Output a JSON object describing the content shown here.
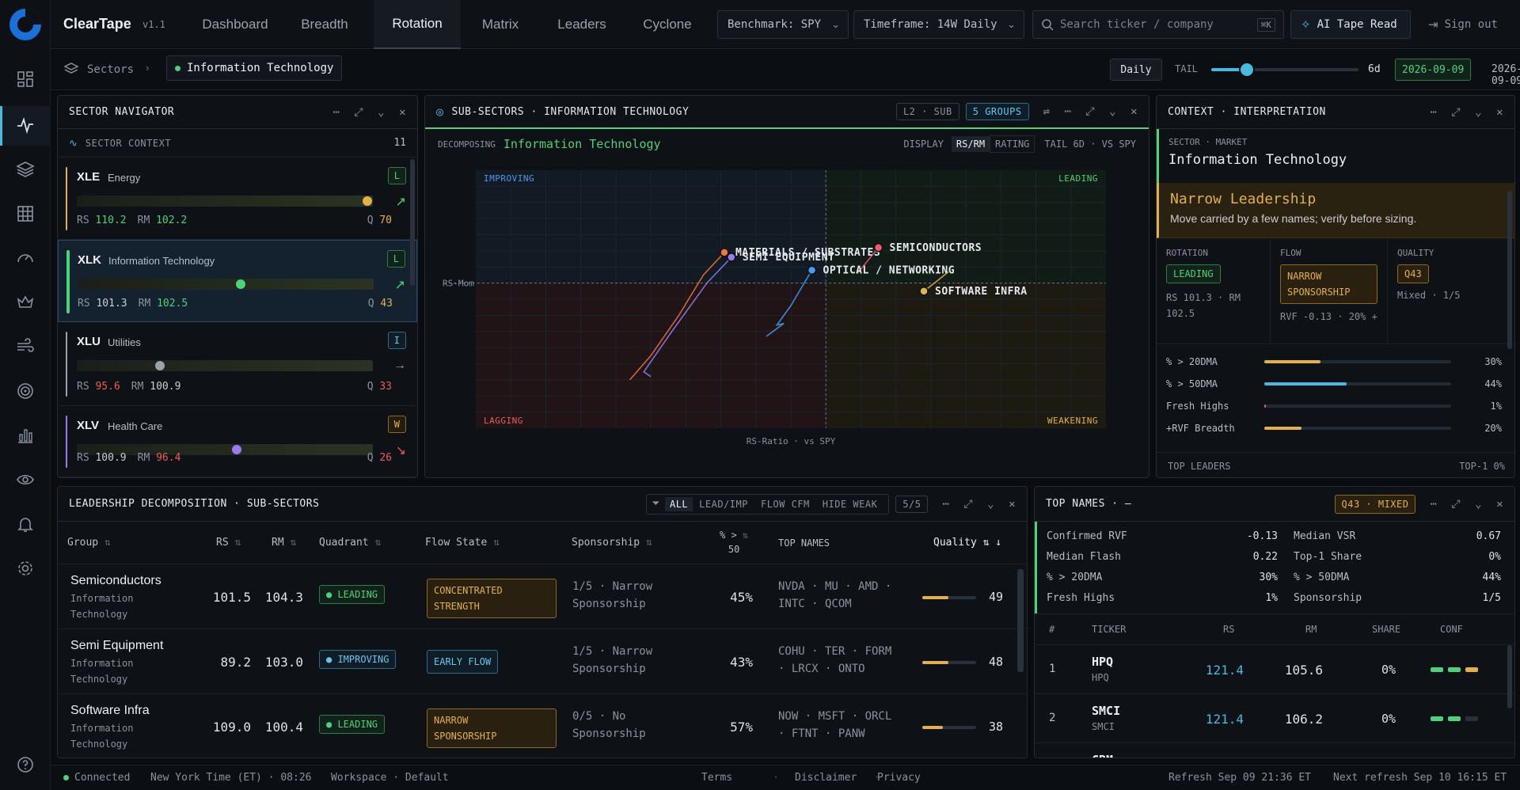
{
  "brand": {
    "name": "ClearTape",
    "version": "v1.1"
  },
  "tabs": [
    "Dashboard",
    "Breadth",
    "Rotation",
    "Matrix",
    "Leaders",
    "Cyclone"
  ],
  "active_tab": "Rotation",
  "header": {
    "benchmark": "Benchmark: SPY",
    "timeframe": "Timeframe: 14W Daily",
    "search_placeholder": "Search ticker / company",
    "search_shortcut": "⌘K",
    "ai_label": "AI Tape Read",
    "signout": "Sign out"
  },
  "crumb": {
    "root": "Sectors",
    "current": "Information Technology",
    "daily": "Daily",
    "tail_label": "TAIL",
    "tail_value": "6d",
    "date_badge": "2026-09-09",
    "date_text": "2026-09-09",
    "tail_fraction": 0.24
  },
  "navigator": {
    "title": "SECTOR NAVIGATOR",
    "context_label": "SECTOR CONTEXT",
    "count": "11",
    "sectors": [
      {
        "ticker": "XLE",
        "name": "Energy",
        "badge": "L",
        "arrow": "↗",
        "rs": "110.2",
        "rm": "102.2",
        "q": "70",
        "dot": 0.98,
        "dot_color": "#e3b04a",
        "rs_color": "#4fd07a",
        "rm_color": "#4fd07a",
        "q_color": "#e3b04a",
        "badge_color": "green"
      },
      {
        "ticker": "XLK",
        "name": "Information Technology",
        "badge": "L",
        "arrow": "↗",
        "rs": "101.3",
        "rm": "102.5",
        "q": "43",
        "dot": 0.55,
        "dot_color": "#4fd07a",
        "rs_color": "#c8cdd4",
        "rm_color": "#4fd07a",
        "q_color": "#e3b04a",
        "badge_color": "green"
      },
      {
        "ticker": "XLU",
        "name": "Utilities",
        "badge": "I",
        "arrow": "→",
        "rs": "95.6",
        "rm": "100.9",
        "q": "33",
        "dot": 0.28,
        "dot_color": "#9aa2ad",
        "rs_color": "#ef5a5a",
        "rm_color": "#c8cdd4",
        "q_color": "#ef5a5a",
        "badge_color": "blue"
      },
      {
        "ticker": "XLV",
        "name": "Health Care",
        "badge": "W",
        "arrow": "↘",
        "rs": "100.9",
        "rm": "96.4",
        "q": "26",
        "dot": 0.54,
        "dot_color": "#9b7af0",
        "rs_color": "#c8cdd4",
        "rm_color": "#ef5a5a",
        "q_color": "#ef5a5a",
        "badge_color": "amber"
      }
    ]
  },
  "subsectors": {
    "title": "SUB-SECTORS · INFORMATION TECHNOLOGY",
    "l2": "L2 · SUB",
    "groups": "5 GROUPS",
    "decomposing_label": "DECOMPOSING",
    "decomposing_value": "Information Technology",
    "display_label": "DISPLAY",
    "display_opts": [
      "RS/RM",
      "RATING"
    ],
    "tail_label": "TAIL 6D · VS SPY",
    "quadrants": {
      "improving": "IMPROVING",
      "leading": "LEADING",
      "lagging": "LAGGING",
      "weakening": "WEAKENING"
    },
    "y_axis": "RS-Mom",
    "x_axis": "RS-Ratio · vs SPY",
    "points": [
      {
        "label": "MATERIALS / SUBSTRATES",
        "x": 97.1,
        "y": 102.9,
        "color": "#f0763c",
        "tail": [
          [
            94.4,
            95.0
          ],
          [
            95.0,
            96.5
          ],
          [
            95.8,
            99.0
          ],
          [
            96.5,
            101.5
          ],
          [
            97.1,
            102.9
          ]
        ]
      },
      {
        "label": "SEMI EQUIPMENT",
        "x": 97.3,
        "y": 102.6,
        "color": "#9b7af0",
        "tail": [
          [
            95.0,
            95.2
          ],
          [
            94.8,
            95.5
          ],
          [
            95.6,
            98.0
          ],
          [
            96.6,
            101.0
          ],
          [
            97.3,
            102.6
          ]
        ]
      },
      {
        "label": "SEMICONDUCTORS",
        "x": 101.5,
        "y": 103.2,
        "color": "#f05a6a",
        "tail": [
          [
            100.9,
            101.6
          ],
          [
            101.5,
            103.2
          ]
        ]
      },
      {
        "label": "OPTICAL / NETWORKING",
        "x": 99.6,
        "y": 101.8,
        "color": "#4a9af0",
        "tail": [
          [
            98.3,
            97.7
          ],
          [
            98.8,
            98.5
          ],
          [
            98.6,
            98.4
          ],
          [
            99.0,
            99.6
          ],
          [
            99.6,
            101.8
          ]
        ]
      },
      {
        "label": "SOFTWARE INFRA",
        "x": 102.8,
        "y": 100.5,
        "color": "#e3b04a",
        "tail": [
          [
            103.5,
            101.7
          ],
          [
            103.1,
            101.0
          ],
          [
            102.8,
            100.5
          ]
        ]
      }
    ]
  },
  "context": {
    "title": "CONTEXT · INTERPRETATION",
    "sector_label": "SECTOR · MARKET",
    "sector_value": "Information Technology",
    "alert_title": "Narrow Leadership",
    "alert_text": "Move carried by a few names; verify before sizing.",
    "rotation_label": "ROTATION",
    "rotation_badge": "LEADING",
    "rotation_text": "RS 101.3 · RM 102.5",
    "flow_label": "FLOW",
    "flow_badge": "NARROW SPONSORSHIP",
    "flow_text": "RVF -0.13 · 20% +",
    "quality_label": "QUALITY",
    "quality_badge": "Q43",
    "quality_text": "Mixed · 1/5",
    "bars": [
      {
        "label": "% > 20DMA",
        "value": "30%",
        "frac": 0.3,
        "color": "#e3b04a"
      },
      {
        "label": "% > 50DMA",
        "value": "44%",
        "frac": 0.44,
        "color": "#4ab8e0"
      },
      {
        "label": "Fresh Highs",
        "value": "1%",
        "frac": 0.01,
        "color": "#ef5a5a"
      },
      {
        "label": "+RVF Breadth",
        "value": "20%",
        "frac": 0.2,
        "color": "#e3b04a"
      }
    ],
    "top_leaders_label": "TOP LEADERS",
    "top_leaders_value": "TOP-1 0%"
  },
  "decomp": {
    "title": "LEADERSHIP DECOMPOSITION · SUB-SECTORS",
    "filters": [
      "ALL",
      "LEAD/IMP",
      "FLOW CFM",
      "HIDE WEAK"
    ],
    "count": "5/5",
    "headers": {
      "group": "Group",
      "rs": "RS",
      "rm": "RM",
      "quadrant": "Quadrant",
      "flow": "Flow State",
      "sponsorship": "Sponsorship",
      "pct": "% >",
      "pct2": "50",
      "top": "TOP NAMES",
      "quality": "Quality"
    },
    "rows": [
      {
        "group": "Semiconductors",
        "parent": "Information",
        "parent2": "Technology",
        "rs": "101.5",
        "rm": "104.3",
        "quadrant": "LEADING",
        "qcolor": "green",
        "flow1": "CONCENTRATED",
        "flow2": "STRENGTH",
        "spon1": "1/5 · Narrow",
        "spon2": "Sponsorship",
        "pct": "45%",
        "top1": "NVDA · MU · AMD ·",
        "top2": "INTC · QCOM",
        "quality": "49",
        "qfrac": 0.49
      },
      {
        "group": "Semi Equipment",
        "parent": "Information",
        "parent2": "Technology",
        "rs": "89.2",
        "rm": "103.0",
        "quadrant": "IMPROVING",
        "qcolor": "blue",
        "flow1": "EARLY FLOW",
        "flow2": "",
        "spon1": "1/5 · Narrow",
        "spon2": "Sponsorship",
        "pct": "43%",
        "top1": "COHU · TER · FORM",
        "top2": "· LRCX · ONTO",
        "quality": "48",
        "qfrac": 0.48
      },
      {
        "group": "Software Infra",
        "parent": "Information",
        "parent2": "Technology",
        "rs": "109.0",
        "rm": "100.4",
        "quadrant": "LEADING",
        "qcolor": "green",
        "flow1": "NARROW",
        "flow2": "SPONSORSHIP",
        "spon1": "0/5 · No",
        "spon2": "Sponsorship",
        "pct": "57%",
        "top1": "NOW · MSFT · ORCL",
        "top2": "· FTNT · PANW",
        "quality": "38",
        "qfrac": 0.38
      }
    ]
  },
  "topnames": {
    "title": "TOP NAMES · —",
    "badge": "Q43 · MIXED",
    "stats": [
      [
        "Confirmed RVF",
        "-0.13",
        "Median VSR",
        "0.67"
      ],
      [
        "Median Flash",
        "0.22",
        "Top-1 Share",
        "0%"
      ],
      [
        "% > 20DMA",
        "30%",
        "% > 50DMA",
        "44%"
      ],
      [
        "Fresh Highs",
        "1%",
        "Sponsorship",
        "1/5"
      ]
    ],
    "headers": [
      "#",
      "TICKER",
      "RS",
      "RM",
      "SHARE",
      "CONF"
    ],
    "rows": [
      {
        "n": "1",
        "ticker": "HPQ",
        "sub": "HPQ",
        "rs": "121.4",
        "rm": "105.6",
        "share": "0%",
        "conf": [
          1,
          1,
          0.5
        ]
      },
      {
        "n": "2",
        "ticker": "SMCI",
        "sub": "SMCI",
        "rs": "121.4",
        "rm": "106.2",
        "share": "0%",
        "conf": [
          1,
          1,
          0
        ]
      },
      {
        "n": "",
        "ticker": "CRM",
        "sub": "",
        "rs": "",
        "rm": "",
        "share": "",
        "conf": []
      }
    ]
  },
  "status": {
    "connected": "Connected",
    "tz": "New York Time (ET) · 08:26",
    "workspace": "Workspace · Default",
    "links": [
      "Terms",
      "Disclaimer",
      "Privacy"
    ],
    "refresh": "Refresh Sep 09 21:36 ET",
    "next": "Next refresh Sep 10 16:15 ET"
  },
  "colors": {
    "accent_green": "#4fd07a",
    "accent_blue": "#4ab8e0",
    "accent_amber": "#e3b04a",
    "red": "#ef5a5a"
  }
}
